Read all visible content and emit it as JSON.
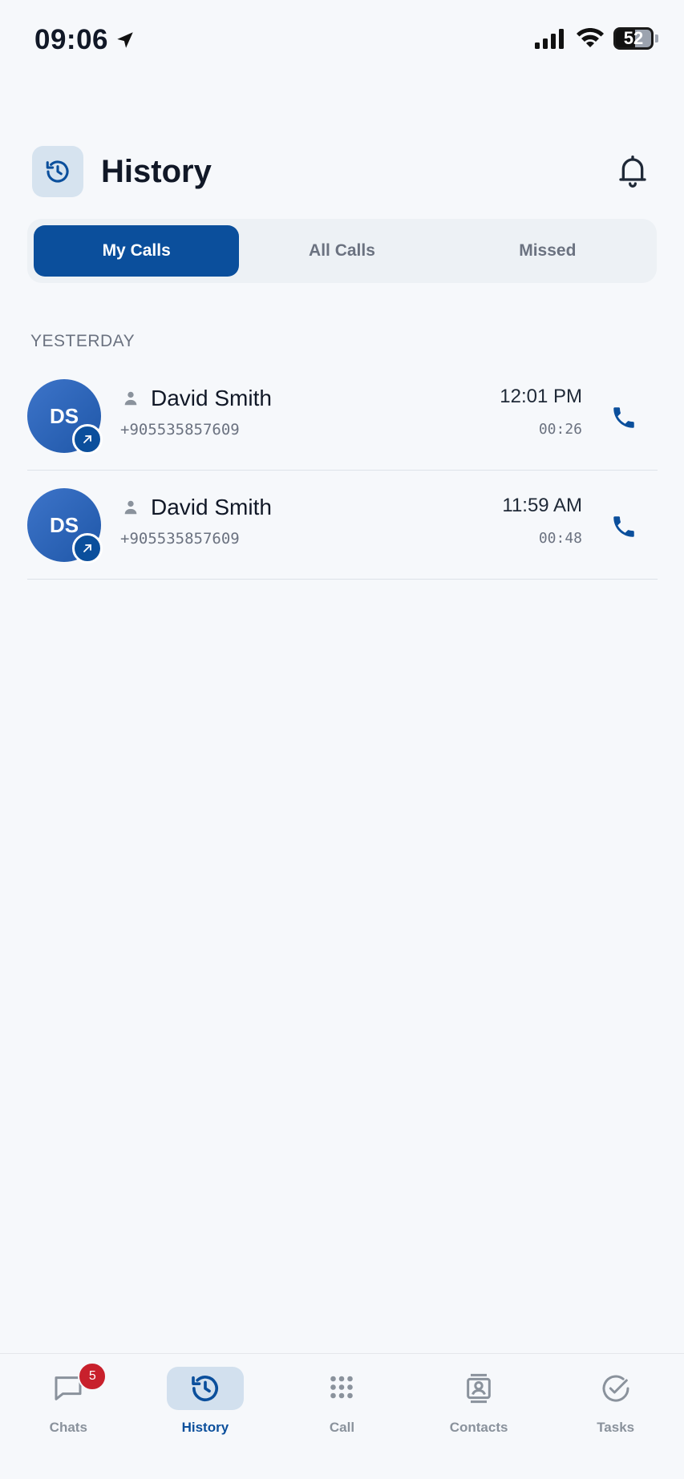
{
  "status_bar": {
    "time": "09:06",
    "battery": "52"
  },
  "header": {
    "title": "History"
  },
  "tabs": [
    {
      "label": "My Calls",
      "active": true
    },
    {
      "label": "All Calls",
      "active": false
    },
    {
      "label": "Missed",
      "active": false
    }
  ],
  "section": {
    "label": "YESTERDAY"
  },
  "calls": [
    {
      "initials": "DS",
      "name": "David Smith",
      "phone": "+905535857609",
      "time": "12:01 PM",
      "duration": "00:26",
      "direction": "outgoing"
    },
    {
      "initials": "DS",
      "name": "David Smith",
      "phone": "+905535857609",
      "time": "11:59 AM",
      "duration": "00:48",
      "direction": "outgoing"
    }
  ],
  "nav": {
    "items": [
      {
        "label": "Chats",
        "icon": "chat-icon",
        "badge": "5"
      },
      {
        "label": "History",
        "icon": "history-icon",
        "active": true
      },
      {
        "label": "Call",
        "icon": "dialpad-icon"
      },
      {
        "label": "Contacts",
        "icon": "contacts-icon"
      },
      {
        "label": "Tasks",
        "icon": "tasks-icon"
      }
    ]
  },
  "colors": {
    "accent": "#0b4f9c",
    "badge": "#c8202c",
    "background": "#f6f8fb"
  }
}
